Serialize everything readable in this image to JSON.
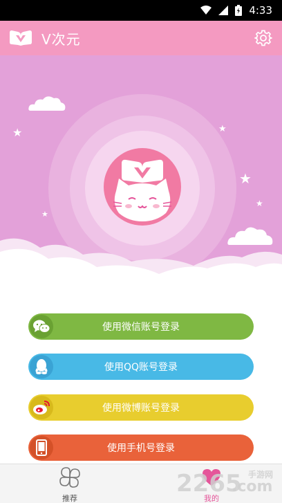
{
  "status_bar": {
    "time": "4:33",
    "icons": [
      "wifi-icon",
      "signal-icon",
      "battery-icon"
    ]
  },
  "app_bar": {
    "title": "V次元",
    "logo": "v-logo-icon",
    "settings_icon": "gear-icon"
  },
  "login_buttons": [
    {
      "label": "使用微信账号登录",
      "icon": "wechat-icon",
      "color": "#7fb843"
    },
    {
      "label": "使用QQ账号登录",
      "icon": "qq-icon",
      "color": "#48b9e6"
    },
    {
      "label": "使用微博账号登录",
      "icon": "weibo-icon",
      "color": "#e8cd2e"
    },
    {
      "label": "使用手机号登录",
      "icon": "phone-icon",
      "color": "#e9623a"
    }
  ],
  "bottom_nav": {
    "recommend": {
      "label": "推荐",
      "icon": "clover-icon"
    },
    "mine": {
      "label": "我的",
      "icon": "heart-icon"
    }
  },
  "watermark": {
    "text": "2265",
    "suffix": ".com",
    "sub": "手游网"
  },
  "colors": {
    "app_bar": "#f49ac1",
    "hero_bg": "#e3a1d9",
    "avatar_bg": "#f17aa3",
    "nav_active": "#e5559a"
  }
}
